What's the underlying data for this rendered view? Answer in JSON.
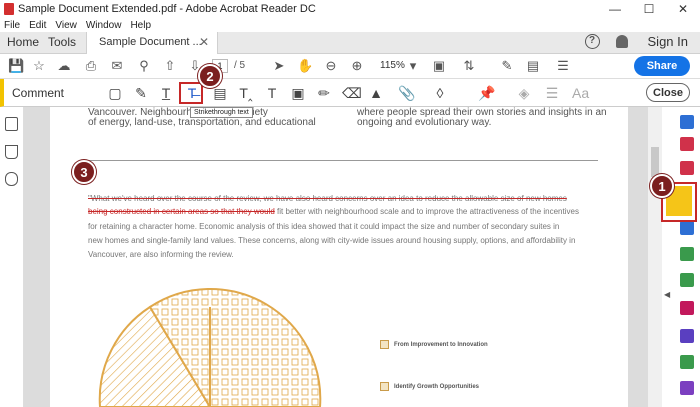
{
  "window": {
    "title": "Sample Document Extended.pdf - Adobe Acrobat Reader DC",
    "controls": [
      "—",
      "☐",
      "✕"
    ]
  },
  "menu": [
    "File",
    "Edit",
    "View",
    "Window",
    "Help"
  ],
  "tabs": {
    "home": "Home",
    "tools": "Tools",
    "document": "Sample Document ...",
    "close": "✕",
    "help": "?",
    "signin": "Sign In"
  },
  "toolbar": {
    "page_current": "1",
    "page_total": "/  5",
    "zoom": "115%",
    "share": "Share"
  },
  "comment_bar": {
    "label": "Comment",
    "close": "Close",
    "tooltip": "Strikethrough text",
    "icons": [
      "sticky-note",
      "highlight",
      "underline",
      "strikethrough",
      "replace-text",
      "insert-text",
      "text-box",
      "text-field",
      "pencil",
      "eraser",
      "stamp",
      "attach",
      "sign",
      "pin",
      "fill",
      "lines",
      "font-size"
    ]
  },
  "badges": [
    "1",
    "2",
    "3"
  ],
  "document": {
    "col1_line1": "Vancouver. Neighbourhood                                    ose a variety",
    "col1_line2": "of energy, land-use, transportation, and educational",
    "col2_line1": "where people spread their own stories and insights in an",
    "col2_line2": "ongoing and evolutionary way.",
    "para_line1": "\"What we've heard over the course of the review, we have also heard concerns over an idea to reduce the allowable size of new homes",
    "para_line2_strike": "being constructed in certain areas so that they would",
    "para_line2_rest": " fit better with neighbourhood scale and to improve the attractiveness of the incentives",
    "para_line3": "for retaining a character home. Economic analysis of this idea showed that it could impact the size and number of secondary suites in",
    "para_line4": "new homes and single-family land values. These concerns, along with city-wide issues around housing supply, options, and affordability in",
    "para_line5": "Vancouver, are also informing the review.",
    "legend1": "From Improvement to Innovation",
    "legend2": "Identify Growth Opportunities"
  },
  "colors": {
    "accent_blue": "#1473e6",
    "comment_yellow": "#f2c300",
    "badge": "#7b1f1f",
    "highlight_red": "#c62828",
    "illustration": "#e0a84a"
  }
}
